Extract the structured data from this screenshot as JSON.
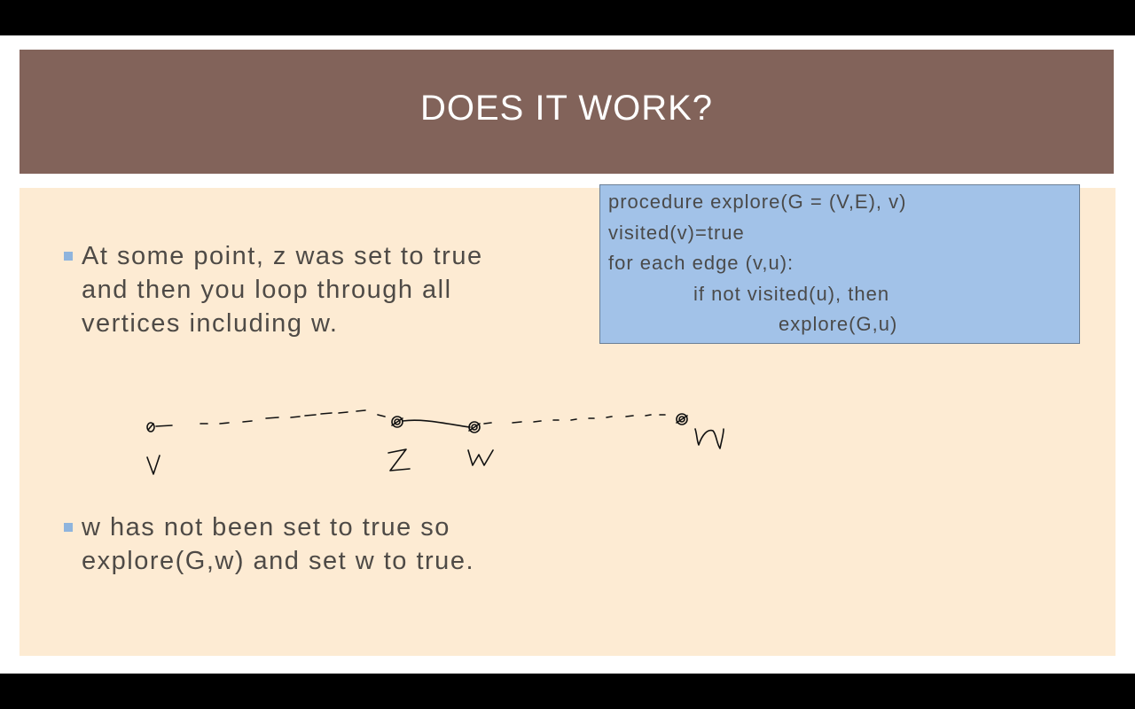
{
  "slide": {
    "title": "DOES IT WORK?",
    "bullets": [
      {
        "lines": [
          "At some point, z was set to true",
          "and then you loop through all",
          "vertices including w."
        ]
      },
      {
        "lines": [
          "w has not been set to true so",
          "explore(G,w) and set w to true."
        ]
      }
    ],
    "code": {
      "lines": [
        "procedure explore(G = (V,E), v)",
        "visited(v)=true",
        "for each edge (v,u):",
        "if not visited(u), then",
        "explore(G,u)"
      ]
    },
    "sketch": {
      "labels": [
        "v",
        "z",
        "w",
        "u"
      ]
    }
  },
  "colors": {
    "title_bar": "#82635a",
    "content_bg": "#fdebd3",
    "code_bg": "#a2c2e8",
    "bullet_marker": "#8fb4dd"
  }
}
